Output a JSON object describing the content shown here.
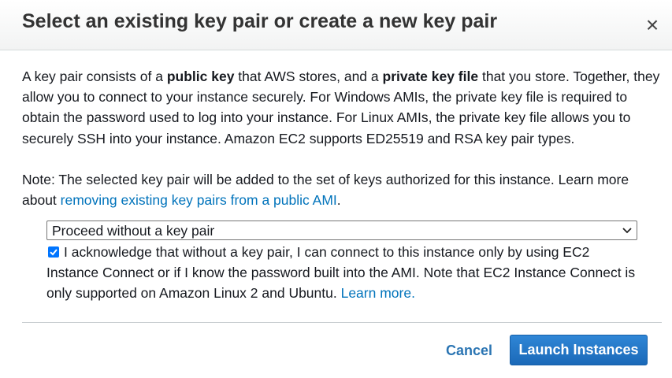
{
  "dialog": {
    "title": "Select an existing key pair or create a new key pair",
    "close_label": "×"
  },
  "intro": {
    "l1_a": "A key pair consists of a ",
    "l1_b": "public key",
    "l1_c": " that AWS stores, and a ",
    "l1_d": "private key file",
    "l1_e": " that you store. Together, they",
    "l2": "allow you to connect to your instance securely. For Windows AMIs, the private key file is required to",
    "l3": "obtain the password used to log into your instance. For Linux AMIs, the private key file allows you to",
    "l4": "securely SSH into your instance. Amazon EC2 supports ED25519 and RSA key pair types."
  },
  "note": {
    "l1": "Note: The selected key pair will be added to the set of keys authorized for this instance. Learn more",
    "l2_a": "about ",
    "link": "removing existing key pairs from a public AMI",
    "l2_b": "."
  },
  "keypair_select": {
    "selected": "Proceed without a key pair"
  },
  "acknowledge": {
    "checked": true,
    "l1": "I acknowledge that without a key pair, I can connect to this instance only by using EC2",
    "l2": "Instance Connect or if I know the password built into the AMI. Note that EC2 Instance Connect is",
    "l3": "only supported on Amazon Linux 2 and Ubuntu. ",
    "learn_more": "Learn more."
  },
  "footer": {
    "cancel_label": "Cancel",
    "launch_label": "Launch Instances"
  }
}
